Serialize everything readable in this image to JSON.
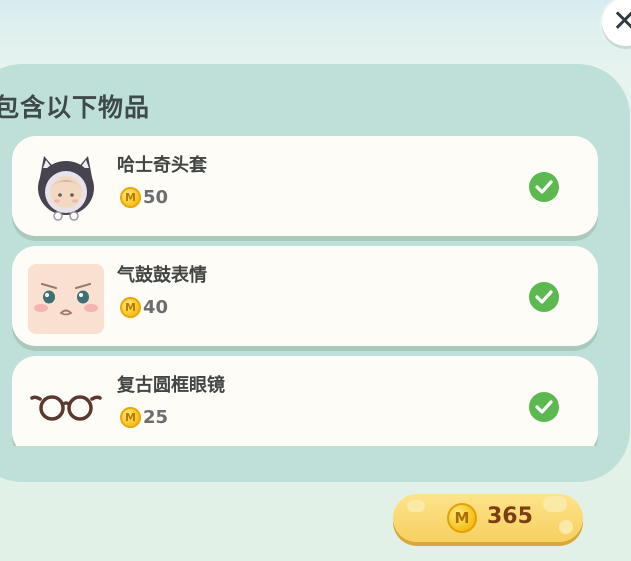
{
  "panel": {
    "title": "包含以下物品",
    "items": [
      {
        "name": "哈士奇头套",
        "price": "50",
        "coin_symbol": "M",
        "icon": "husky-hood-icon",
        "status": "owned"
      },
      {
        "name": "气鼓鼓表情",
        "price": "40",
        "coin_symbol": "M",
        "icon": "pouting-face-icon",
        "status": "owned"
      },
      {
        "name": "复古圆框眼镜",
        "price": "25",
        "coin_symbol": "M",
        "icon": "round-glasses-icon",
        "status": "owned"
      }
    ]
  },
  "wallet": {
    "balance": "365",
    "coin_symbol": "M"
  },
  "colors": {
    "panel": "#bfe0d8",
    "card": "#fefcf6",
    "check": "#5bb94f",
    "coin": "#f6c21a",
    "balance_bar": "#f7d060"
  }
}
